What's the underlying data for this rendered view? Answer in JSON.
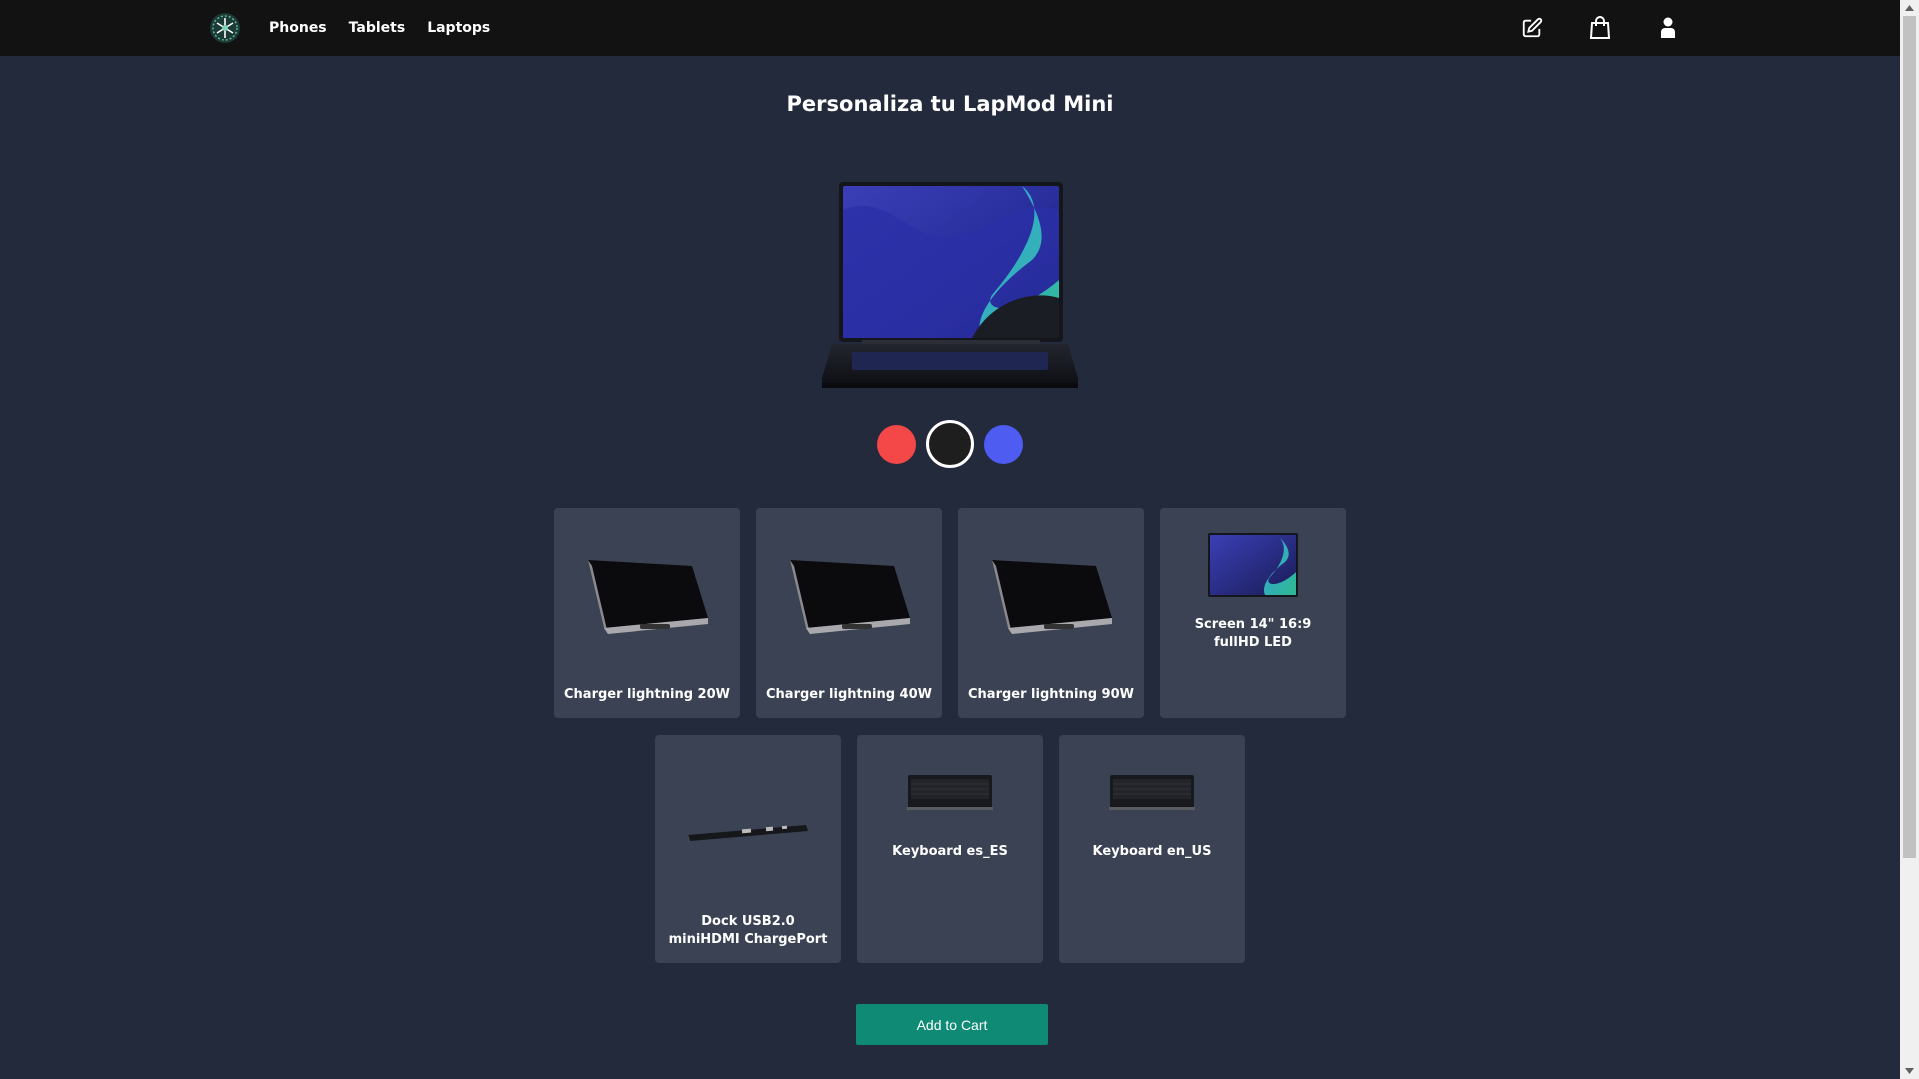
{
  "nav": {
    "links": [
      "Phones",
      "Tablets",
      "Laptops"
    ],
    "icons": [
      "edit-icon",
      "shopping-bag-icon",
      "user-icon"
    ]
  },
  "title": "Personaliza tu LapMod Mini",
  "colors": {
    "background": "#232a3c",
    "navbar": "#121212",
    "card": "#3b4253",
    "accent": "#0f8a74"
  },
  "swatches": [
    {
      "name": "red",
      "color": "#f44848",
      "selected": false
    },
    {
      "name": "black",
      "color": "#1e1e1e",
      "selected": true
    },
    {
      "name": "blue",
      "color": "#4e5cf2",
      "selected": false
    }
  ],
  "options": {
    "row1": [
      {
        "label": "Charger lightning 20W",
        "image": "charger"
      },
      {
        "label": "Charger lightning 40W",
        "image": "charger"
      },
      {
        "label": "Charger lightning 90W",
        "image": "charger"
      },
      {
        "label": "Screen 14\" 16:9 fullHD LED",
        "image": "screen"
      }
    ],
    "row2": [
      {
        "label": "Dock USB2.0 miniHDMI ChargePort",
        "image": "dock"
      },
      {
        "label": "Keyboard es_ES",
        "image": "keyboard"
      },
      {
        "label": "Keyboard en_US",
        "image": "keyboard"
      }
    ]
  },
  "add_to_cart_label": "Add to Cart"
}
